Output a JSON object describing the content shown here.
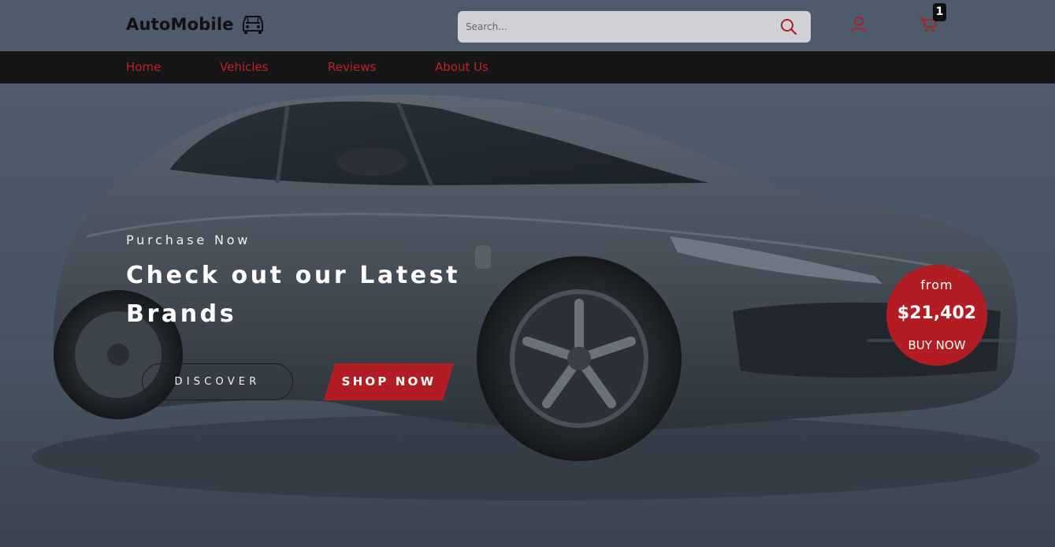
{
  "brand": {
    "name": "AutoMobile",
    "icon": "car-front-icon"
  },
  "search": {
    "placeholder": "Search...",
    "icon": "search-icon"
  },
  "header": {
    "user_icon": "user-icon",
    "cart_icon": "cart-icon",
    "cart_count": "1"
  },
  "nav": {
    "items": [
      {
        "label": "Home"
      },
      {
        "label": "Vehicles"
      },
      {
        "label": "Reviews"
      },
      {
        "label": "About Us"
      }
    ]
  },
  "hero": {
    "kicker": "Purchase Now",
    "title": "Check out our Latest Brands",
    "discover_label": "DISCOVER",
    "shop_label": "SHOP NOW"
  },
  "price_badge": {
    "from": "from",
    "price": "$21,402",
    "cta": "BUY NOW"
  },
  "colors": {
    "accent": "#b21d24",
    "nav_bg": "#161616",
    "header_bg": "#4d5b6b",
    "search_bg": "#cfd1d4",
    "badge_bg": "#0c1013"
  }
}
